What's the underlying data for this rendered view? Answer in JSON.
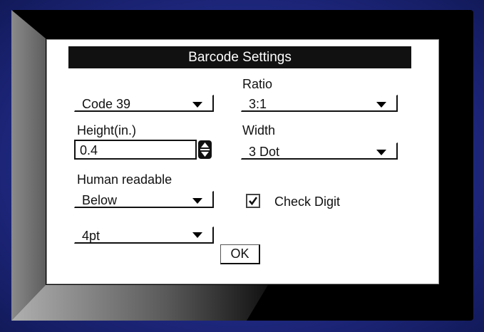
{
  "dialog": {
    "title": "Barcode Settings"
  },
  "barcode_type": {
    "value": "Code 39"
  },
  "ratio": {
    "label": "Ratio",
    "value": "3:1"
  },
  "height": {
    "label": "Height(in.)",
    "value": "0.4"
  },
  "width": {
    "label": "Width",
    "value": "3 Dot"
  },
  "human_readable": {
    "label": "Human readable",
    "value": "Below"
  },
  "check_digit": {
    "label": "Check Digit",
    "checked": true
  },
  "font_size": {
    "value": "4pt"
  },
  "ok_button": {
    "label": "OK"
  },
  "colors": {
    "frame": "#1e2a8c",
    "title_bar": "#111111",
    "panel": "#ffffff"
  }
}
